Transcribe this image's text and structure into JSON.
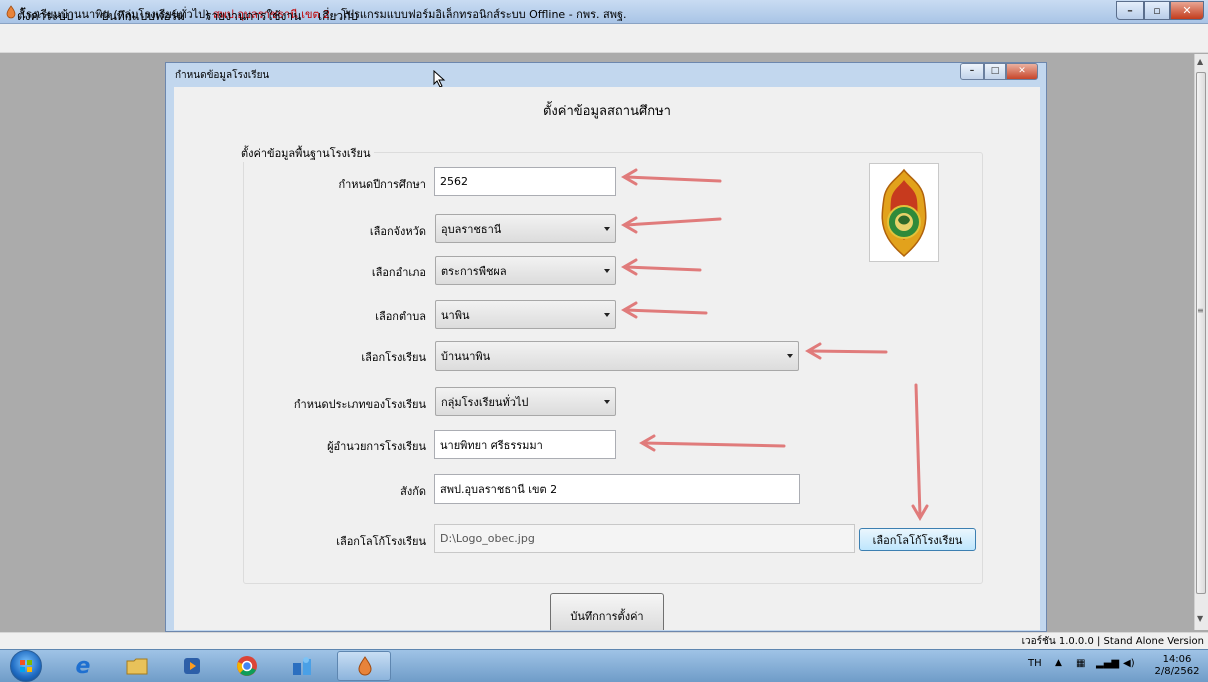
{
  "window": {
    "title_black": "โรงเรียนบ้านนาพิน (กลุ่มโรงเรียนทั่วไป)",
    "title_red": "สพป.อุบลราชธานี เขต 2",
    "title_rest": "- โปรแกรมแบบฟอร์มอิเล็กทรอนิกส์ระบบ Offline - กพร. สพฐ."
  },
  "menu": [
    "ตั้งค่าระบบ",
    "บันทึกแบบฟอร์ม",
    "รายงานการใช้งาน",
    "เกี่ยวกับ"
  ],
  "child": {
    "title": "กำหนดข้อมูลโรงเรียน",
    "heading": "ตั้งค่าข้อมูลสถานศึกษา",
    "group_label": "ตั้งค่าข้อมูลพื้นฐานโรงเรียน"
  },
  "form": {
    "year_label": "กำหนดปีการศึกษา",
    "year_value": "2562",
    "province_label": "เลือกจังหวัด",
    "province_value": "อุบลราชธานี",
    "district_label": "เลือกอำเภอ",
    "district_value": "ตระการพืชผล",
    "subdistrict_label": "เลือกตำบล",
    "subdistrict_value": "นาพิน",
    "school_label": "เลือกโรงเรียน",
    "school_value": "บ้านนาพิน",
    "type_label": "กำหนดประเภทของโรงเรียน",
    "type_value": "กลุ่มโรงเรียนทั่วไป",
    "director_label": "ผู้อำนวยการโรงเรียน",
    "director_value": "นายพิทยา ศรีธรรมมา",
    "affiliation_label": "สังกัด",
    "affiliation_value": "สพป.อุบลราชธานี เขต 2",
    "logo_label": "เลือกโลโก้โรงเรียน",
    "logo_path": "D:\\Logo_obec.jpg",
    "logo_button": "เลือกโลโก้โรงเรียน",
    "save_button": "บันทึกการตั้งค่า"
  },
  "status": {
    "version": "เวอร์ชัน 1.0.0.0 | Stand Alone Version"
  },
  "tray": {
    "lang": "TH",
    "time": "14:06",
    "date": "2/8/2562"
  },
  "colors": {
    "arrow": "#e07b7b",
    "title_red": "#c00000"
  }
}
